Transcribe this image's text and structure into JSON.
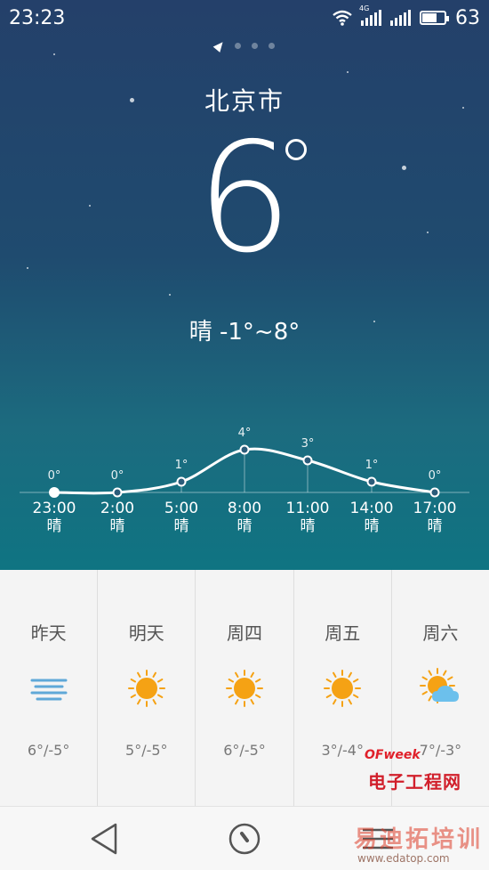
{
  "status_bar": {
    "time": "23:23",
    "network": "4G",
    "battery": "63",
    "battery_level": 0.63
  },
  "city": "北京市",
  "current_temp": "6",
  "condition": "晴 -1°~8°",
  "hourly": {
    "temps_c": [
      0,
      0,
      1,
      4,
      3,
      1,
      0
    ],
    "labels": [
      "0°",
      "0°",
      "1°",
      "4°",
      "3°",
      "1°",
      "0°"
    ],
    "times": [
      "23:00",
      "2:00",
      "5:00",
      "8:00",
      "11:00",
      "14:00",
      "17:00"
    ],
    "conditions": [
      "晴",
      "晴",
      "晴",
      "晴",
      "晴",
      "晴",
      "晴"
    ]
  },
  "daily": [
    {
      "name": "昨天",
      "icon": "haze-icon",
      "range": "6°/-5°"
    },
    {
      "name": "明天",
      "icon": "sun-icon",
      "range": "5°/-5°"
    },
    {
      "name": "周四",
      "icon": "sun-icon",
      "range": "6°/-5°"
    },
    {
      "name": "周五",
      "icon": "sun-icon",
      "range": "3°/-4°"
    },
    {
      "name": "周六",
      "icon": "sun-cloud-icon",
      "range": "7°/-3°"
    }
  ],
  "watermark": {
    "brand": "OFweek",
    "site": "电子工程网",
    "edu": "易迪拓培训",
    "url": "www.edatop.com"
  },
  "colors": {
    "sun": "#f5a214",
    "haze": "#5fa8d8",
    "cloud": "#6cc0ec"
  }
}
